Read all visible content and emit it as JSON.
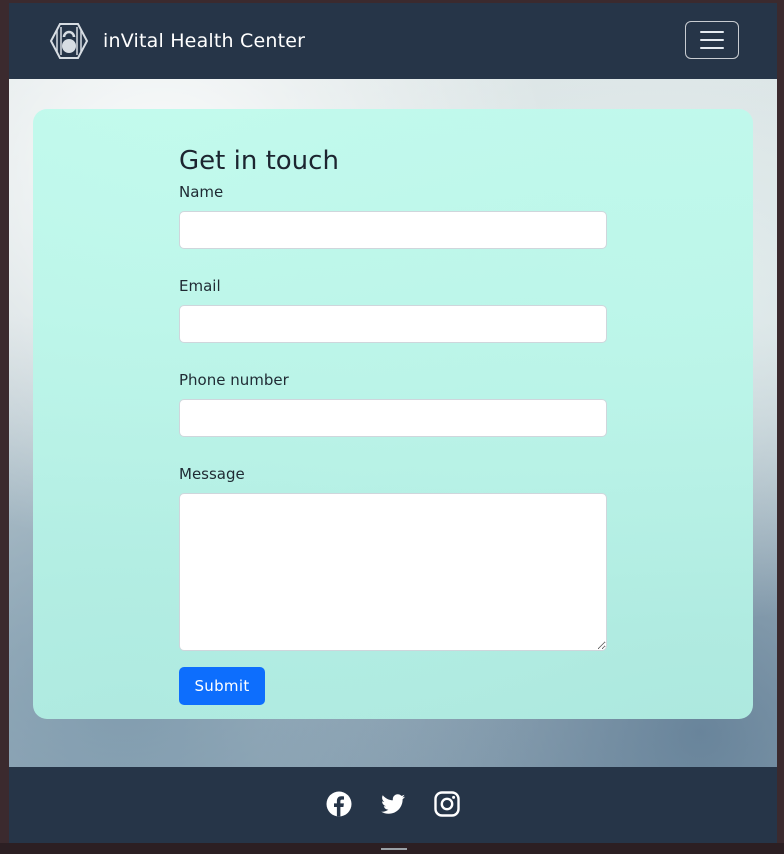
{
  "navbar": {
    "brand_name": "inVital Health Center",
    "logo_icon": "kettlebell-logo-icon",
    "toggle_icon": "hamburger-menu-icon"
  },
  "form": {
    "title": "Get in touch",
    "name_label": "Name",
    "name_value": "",
    "email_label": "Email",
    "email_value": "",
    "phone_label": "Phone number",
    "phone_value": "",
    "message_label": "Message",
    "message_value": "",
    "submit_label": "Submit"
  },
  "footer": {
    "social_icons": [
      "facebook-icon",
      "twitter-icon",
      "instagram-icon"
    ]
  },
  "colors": {
    "navbar_bg": "#263548",
    "card_bg": "#bef5e9",
    "submit_bg": "#0d6efd"
  }
}
